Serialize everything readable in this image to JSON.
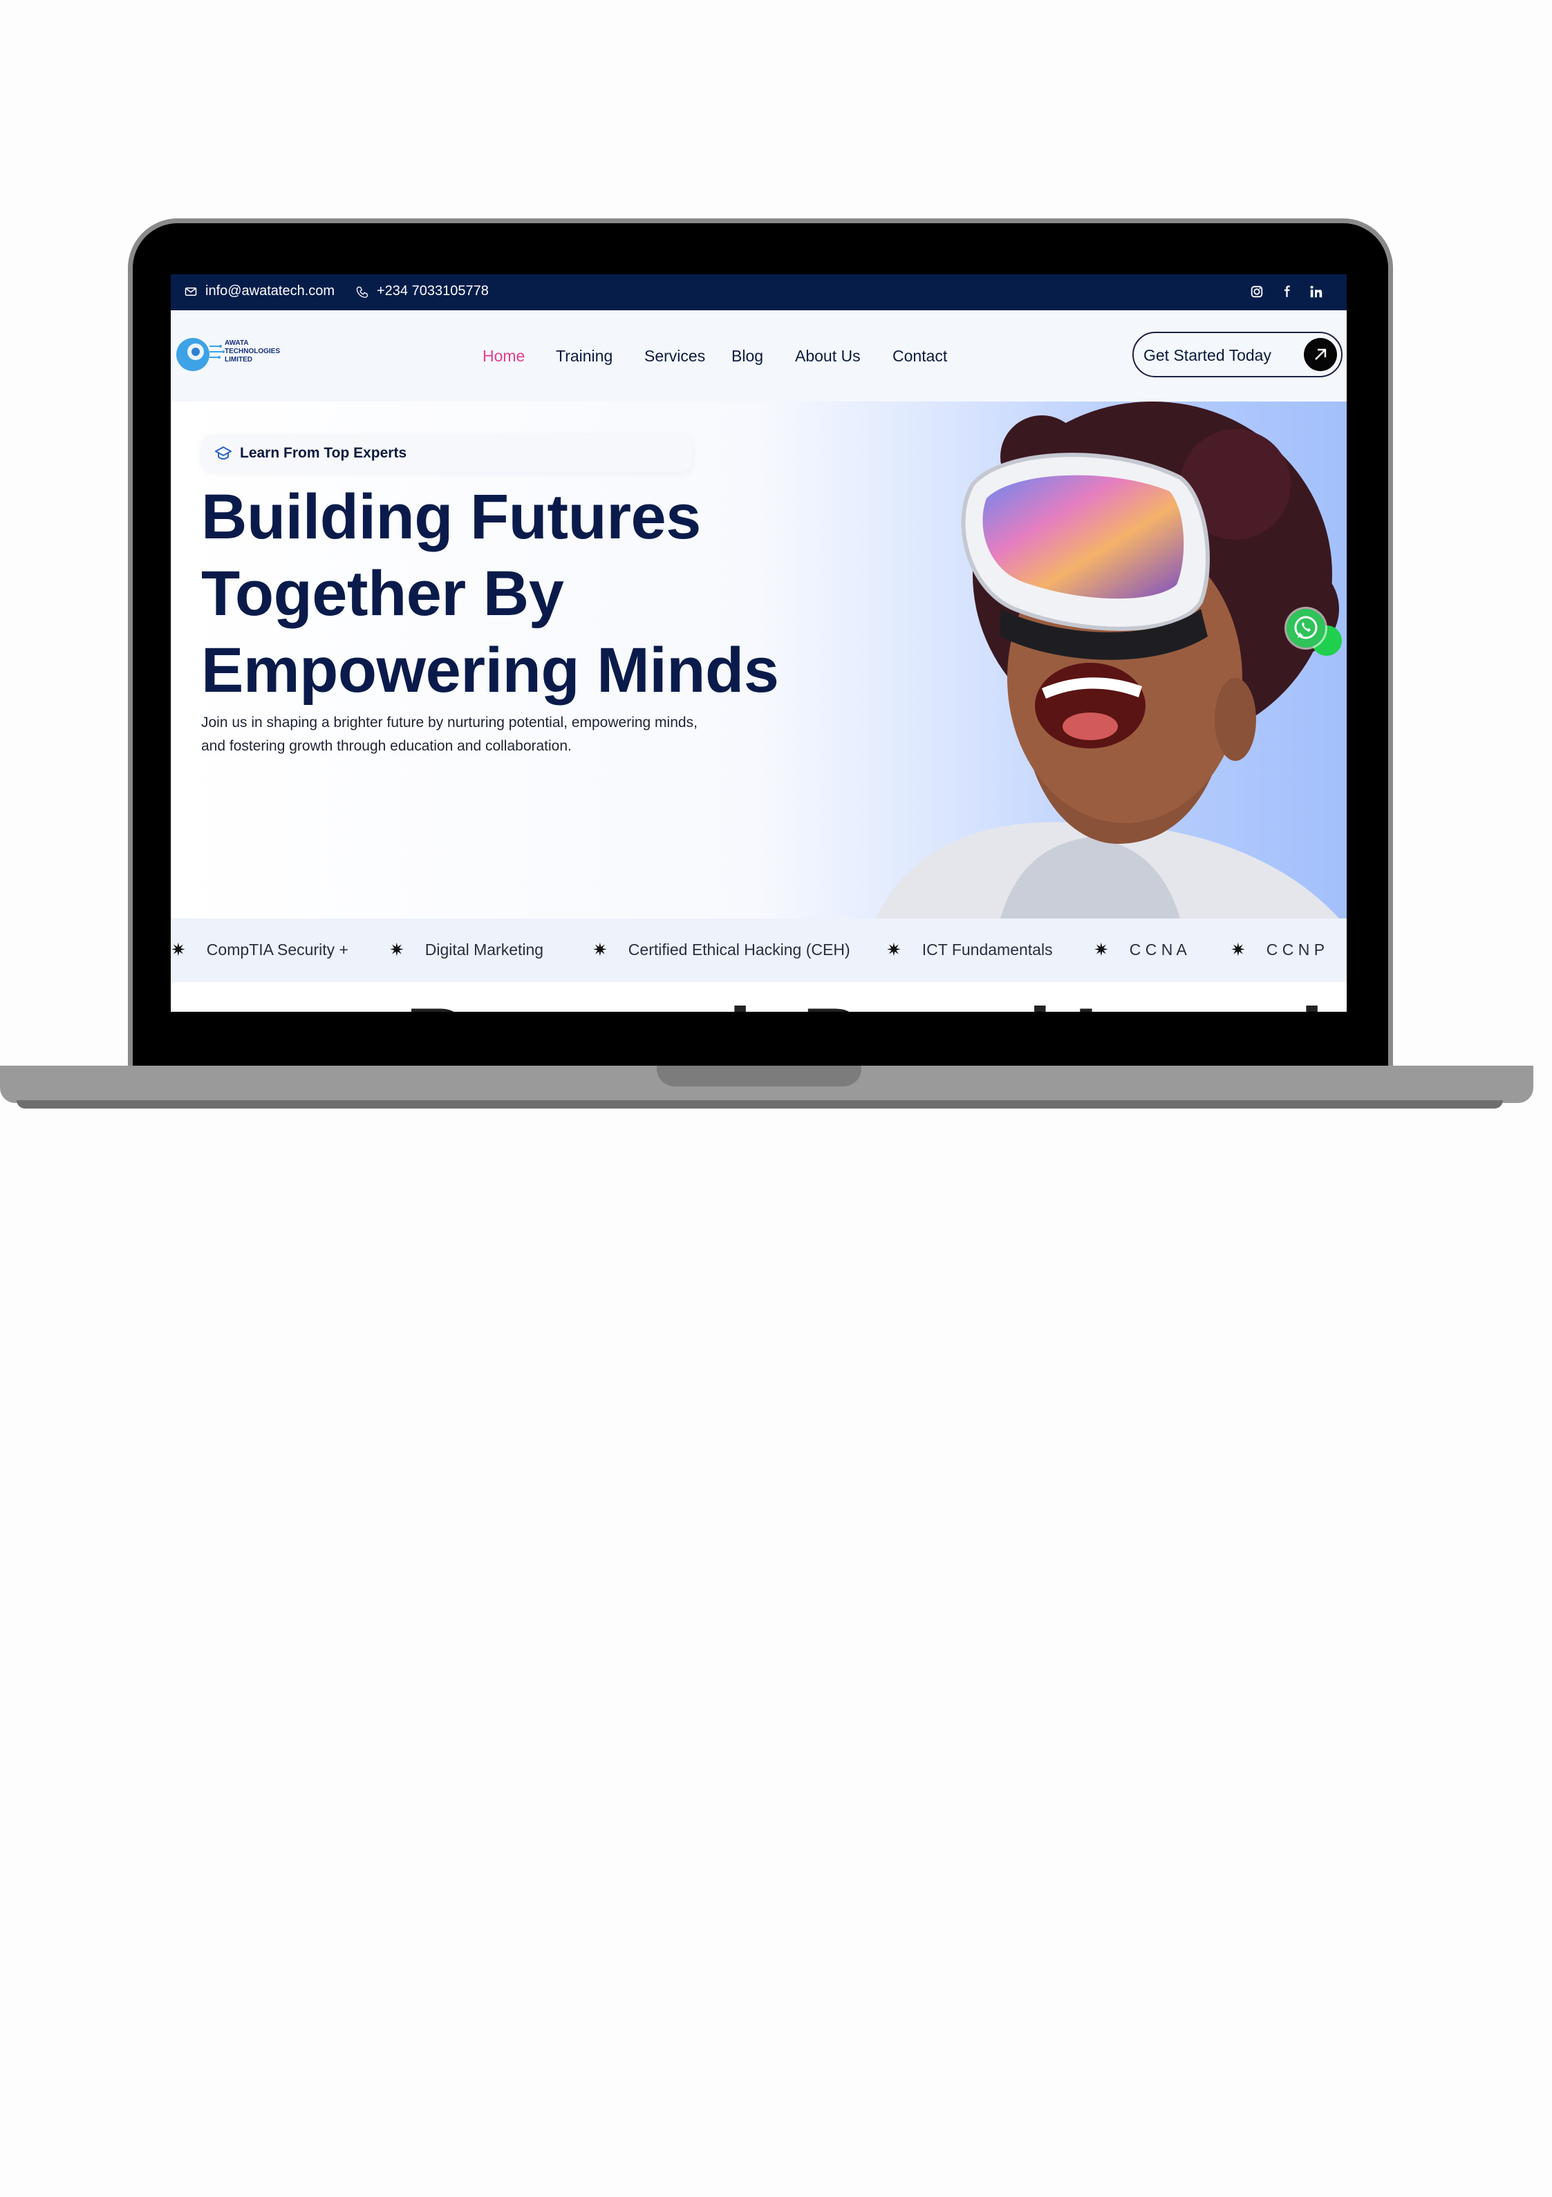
{
  "topbar": {
    "email": "info@awatatech.com",
    "phone": "+234 7033105778",
    "socials": [
      "instagram-icon",
      "facebook-icon",
      "linkedin-icon"
    ]
  },
  "brand": {
    "name_line1": "AWATA",
    "name_line2": "TECHNOLOGIES",
    "name_line3": "LIMITED"
  },
  "nav": {
    "items": [
      {
        "label": "Home",
        "active": true
      },
      {
        "label": "Training"
      },
      {
        "label": "Services"
      },
      {
        "label": "Blog"
      },
      {
        "label": "About Us"
      },
      {
        "label": "Contact"
      }
    ],
    "cta_label": "Get Started Today"
  },
  "hero": {
    "badge": "Learn From Top Experts",
    "headline_line1": "Building Futures",
    "headline_line2": "Together By",
    "headline_line3": "Empowering Minds",
    "subtext_line1": "Join us in shaping a brighter future by nurturing potential, empowering minds,",
    "subtext_line2": "and fostering growth through education and collaboration."
  },
  "ticker": {
    "items": [
      "CompTIA Security +",
      "Digital Marketing",
      "Certified Ethical Hacking (CEH)",
      "ICT Fundamentals",
      "C C N A",
      "C C N P"
    ]
  },
  "next_section": {
    "heading_partial": "Research Based Learning"
  },
  "colors": {
    "topbar_bg": "#061d4a",
    "nav_active": "#e43f8d",
    "headline": "#0a1b4b",
    "whatsapp": "#2fc35a"
  }
}
